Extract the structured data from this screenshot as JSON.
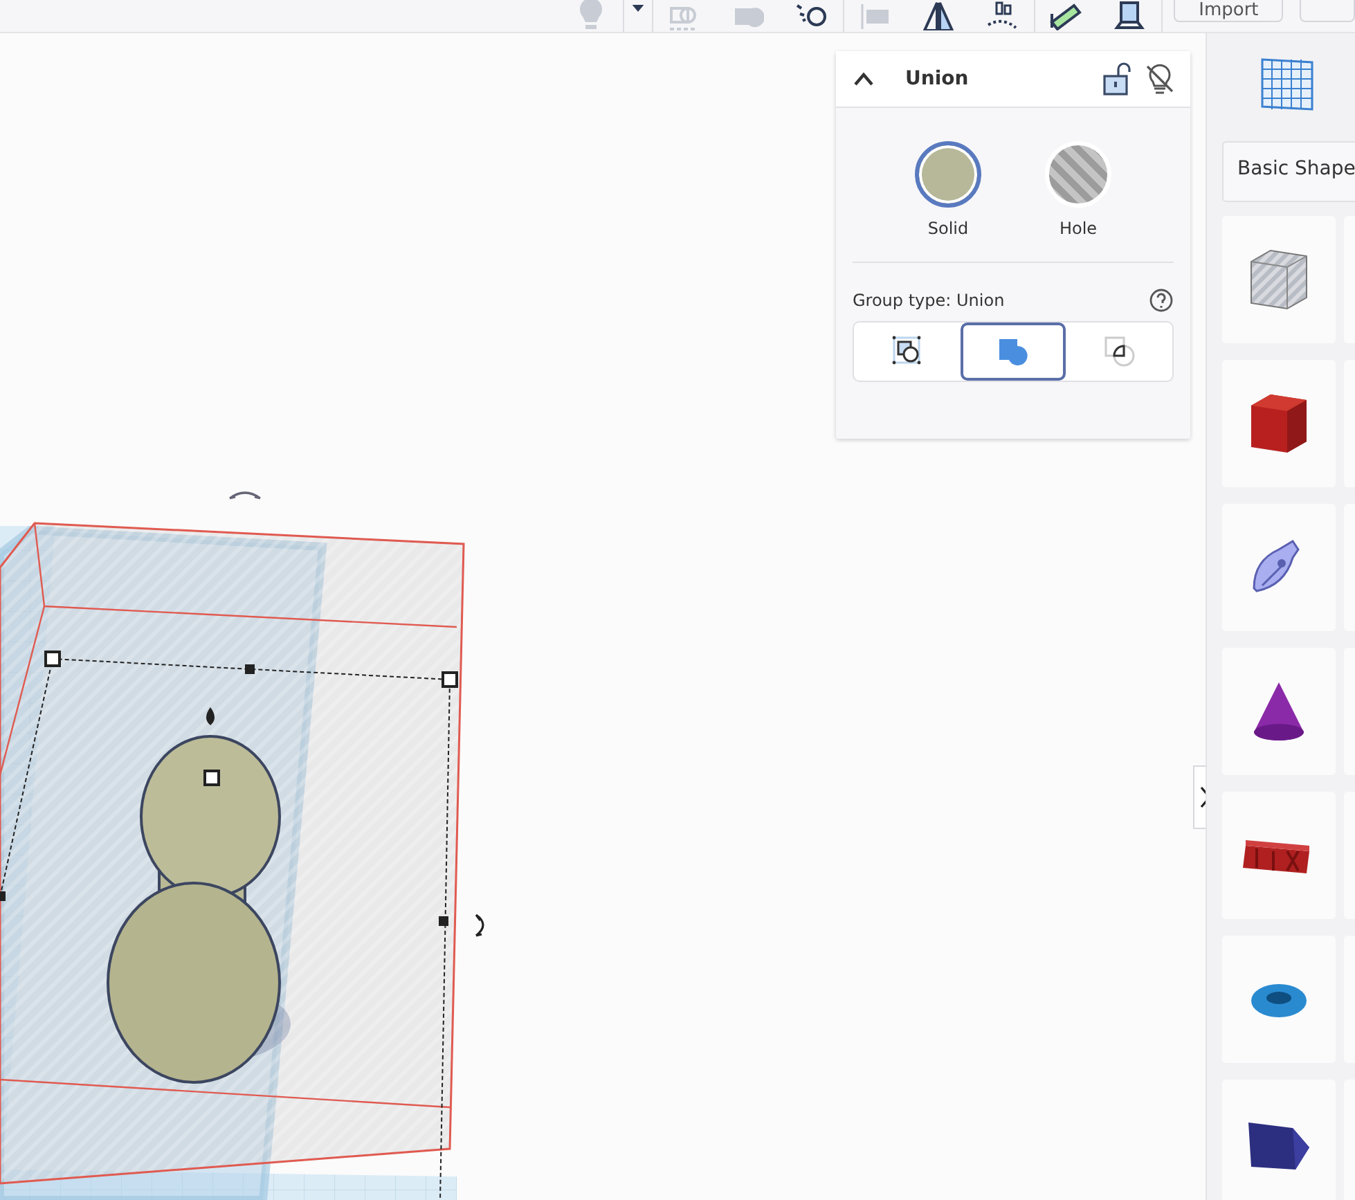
{
  "toolbar": {
    "tools": [
      {
        "kind": "bulb",
        "disabled": true
      },
      {
        "kind": "caret",
        "disabled": false
      },
      {
        "kind": "group",
        "disabled": true
      },
      {
        "kind": "blob",
        "disabled": true
      },
      {
        "kind": "ring",
        "disabled": false
      },
      {
        "kind": "align",
        "disabled": true
      },
      {
        "kind": "mirror",
        "disabled": false
      },
      {
        "kind": "dots",
        "disabled": false
      },
      {
        "kind": "ruler",
        "disabled": false
      },
      {
        "kind": "camera",
        "disabled": false
      }
    ],
    "import_button": "Import"
  },
  "inspector": {
    "title": "Union",
    "expanded": true,
    "locked": false,
    "modes": [
      {
        "label": "Solid",
        "kind": "solid",
        "selected": true
      },
      {
        "label": "Hole",
        "kind": "hole",
        "selected": false
      }
    ],
    "group_type_label": "Group type: Union",
    "group_types": [
      {
        "kind": "shapes",
        "selected": false
      },
      {
        "kind": "union",
        "selected": true
      },
      {
        "kind": "intersect",
        "selected": false
      }
    ]
  },
  "sidebar": {
    "category": "Basic Shape",
    "shapes": [
      {
        "kind": "box-hole"
      },
      {
        "kind": "box"
      },
      {
        "kind": "scribble"
      },
      {
        "kind": "cone"
      },
      {
        "kind": "text"
      },
      {
        "kind": "torus"
      },
      {
        "kind": "wedge"
      }
    ]
  }
}
